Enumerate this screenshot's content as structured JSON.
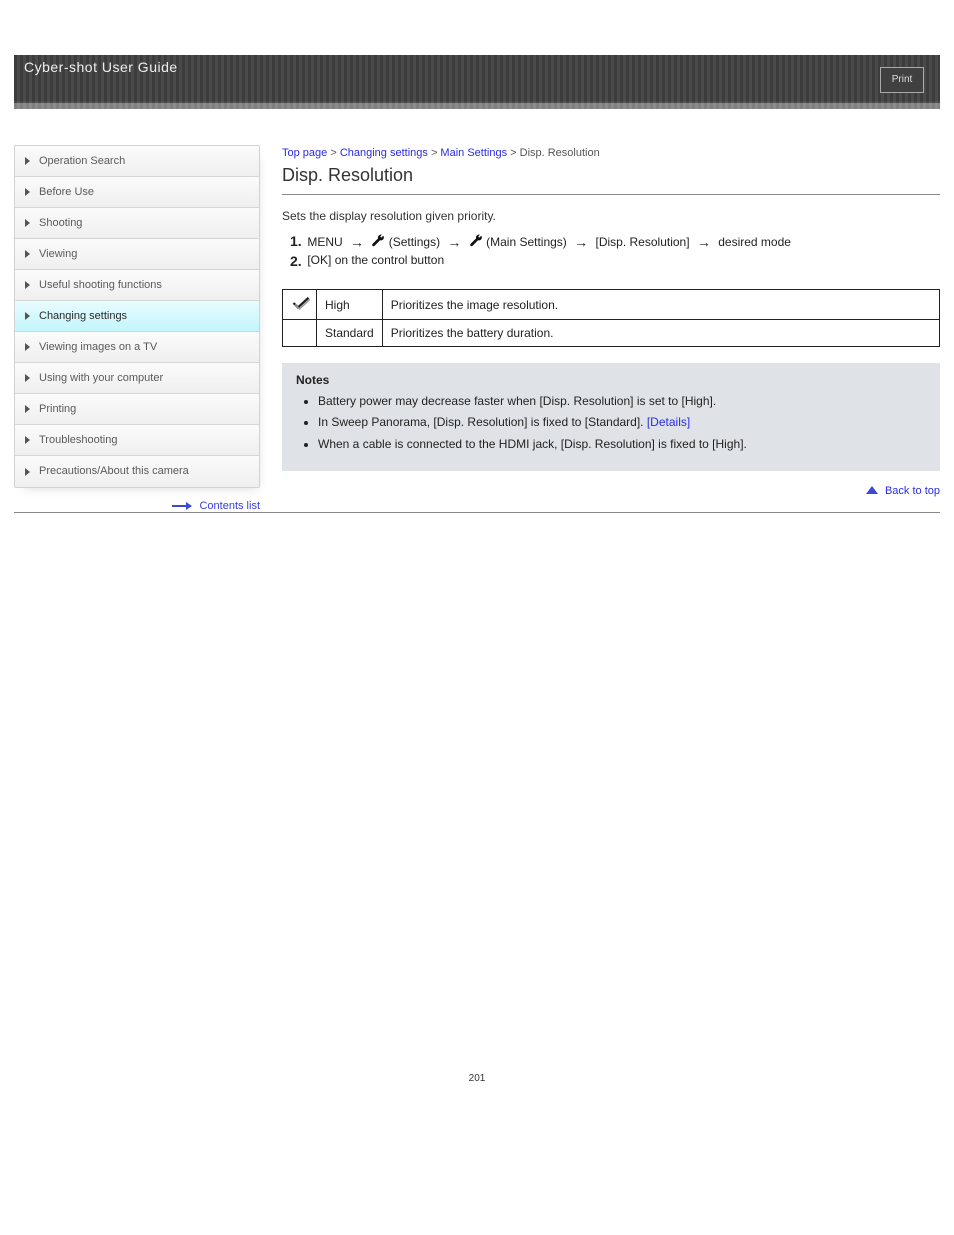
{
  "banner": {
    "title": "Cyber-shot User Guide",
    "print_label": "Print"
  },
  "breadcrumb": {
    "top": "Top page",
    "sep": " > ",
    "cat": "Changing settings",
    "sub": "Main Settings",
    "current": "Disp. Resolution"
  },
  "article": {
    "title": "Disp. Resolution",
    "intro": "Sets the display resolution given priority.",
    "steps": {
      "label1": "1.",
      "pre1": "MENU",
      "mid1": "(Settings)",
      "mid2": "(Main Settings)",
      "end1": "[Disp. Resolution]",
      "trail1": "desired mode",
      "label2": "2.",
      "body2_a": "[OK]",
      "body2_b": "on the control button"
    },
    "table": {
      "r1c2": "High",
      "r1c3": "Prioritizes the image resolution.",
      "r2c2": "Standard",
      "r2c3": "Prioritizes the battery duration."
    },
    "notes_title": "Notes",
    "notes": [
      "Battery power may decrease faster when [Disp. Resolution] is set to [High].",
      {
        "pre": "In Sweep Panorama, [Disp. Resolution] is fixed to [Standard]. ",
        "link": "[Details]"
      },
      "When a cable is connected to the HDMI jack, [Disp. Resolution] is fixed to [High]."
    ]
  },
  "sidebar": {
    "items": [
      "Operation Search",
      "Before Use",
      "Shooting",
      "Viewing",
      "Useful shooting functions",
      "Changing settings",
      "Viewing images on a TV",
      "Using with your computer",
      "Printing",
      "Troubleshooting",
      "Precautions/About this camera"
    ],
    "active_index": 5,
    "contents_link": "Contents list"
  },
  "back_top": "Back to top",
  "page_number": "201"
}
